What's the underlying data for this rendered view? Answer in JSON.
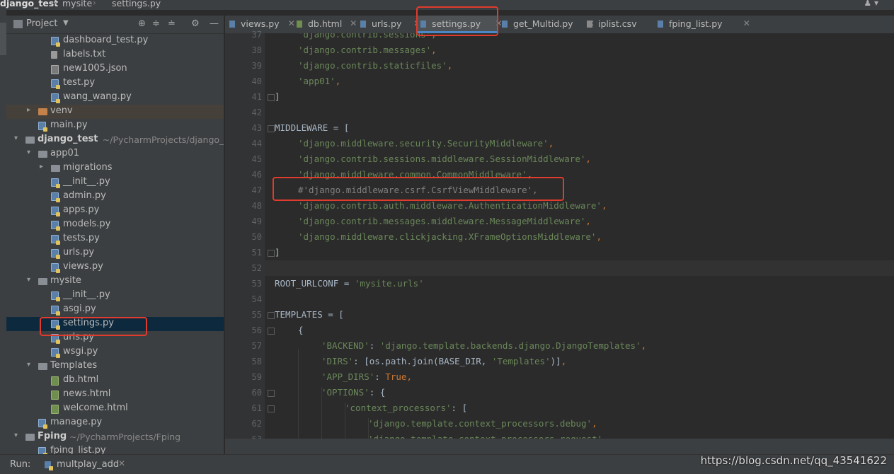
{
  "breadcrumb": {
    "project": "django_test",
    "folder": "mysite",
    "file": "settings.py",
    "user_icon": "user-icon"
  },
  "project_panel": {
    "title": "Project",
    "dropdown_icon": "chevron-down-icon"
  },
  "tree": [
    {
      "indent": 2,
      "arrow": "",
      "icon": "py",
      "name": "dashboard_test.py"
    },
    {
      "indent": 2,
      "arrow": "",
      "icon": "txt",
      "name": "labels.txt"
    },
    {
      "indent": 2,
      "arrow": "",
      "icon": "json",
      "name": "new1005.json"
    },
    {
      "indent": 2,
      "arrow": "",
      "icon": "py",
      "name": "test.py"
    },
    {
      "indent": 2,
      "arrow": "",
      "icon": "py",
      "name": "wang_wang.py"
    },
    {
      "indent": 1,
      "arrow": "right",
      "icon": "folder-orange",
      "name": "venv"
    },
    {
      "indent": 1,
      "arrow": "",
      "icon": "py",
      "name": "main.py"
    },
    {
      "indent": 0,
      "arrow": "down",
      "icon": "folder",
      "name": "django_test",
      "bold": true,
      "path": "~/PycharmProjects/django_tes"
    },
    {
      "indent": 1,
      "arrow": "down",
      "icon": "folder",
      "name": "app01"
    },
    {
      "indent": 2,
      "arrow": "right",
      "icon": "folder",
      "name": "migrations"
    },
    {
      "indent": 2,
      "arrow": "",
      "icon": "py",
      "name": "__init__.py"
    },
    {
      "indent": 2,
      "arrow": "",
      "icon": "py",
      "name": "admin.py"
    },
    {
      "indent": 2,
      "arrow": "",
      "icon": "py",
      "name": "apps.py"
    },
    {
      "indent": 2,
      "arrow": "",
      "icon": "py",
      "name": "models.py"
    },
    {
      "indent": 2,
      "arrow": "",
      "icon": "py",
      "name": "tests.py"
    },
    {
      "indent": 2,
      "arrow": "",
      "icon": "py",
      "name": "urls.py"
    },
    {
      "indent": 2,
      "arrow": "",
      "icon": "py",
      "name": "views.py"
    },
    {
      "indent": 1,
      "arrow": "down",
      "icon": "folder",
      "name": "mysite"
    },
    {
      "indent": 2,
      "arrow": "",
      "icon": "py",
      "name": "__init__.py"
    },
    {
      "indent": 2,
      "arrow": "",
      "icon": "py",
      "name": "asgi.py"
    },
    {
      "indent": 2,
      "arrow": "",
      "icon": "py",
      "name": "settings.py",
      "selected": true
    },
    {
      "indent": 2,
      "arrow": "",
      "icon": "py",
      "name": "urls.py"
    },
    {
      "indent": 2,
      "arrow": "",
      "icon": "py",
      "name": "wsgi.py"
    },
    {
      "indent": 1,
      "arrow": "down",
      "icon": "folder",
      "name": "Templates"
    },
    {
      "indent": 2,
      "arrow": "",
      "icon": "html",
      "name": "db.html"
    },
    {
      "indent": 2,
      "arrow": "",
      "icon": "html",
      "name": "news.html"
    },
    {
      "indent": 2,
      "arrow": "",
      "icon": "html",
      "name": "welcome.html"
    },
    {
      "indent": 1,
      "arrow": "",
      "icon": "py",
      "name": "manage.py"
    },
    {
      "indent": 0,
      "arrow": "down",
      "icon": "folder",
      "name": "Fping",
      "bold": true,
      "path": "~/PycharmProjects/Fping"
    },
    {
      "indent": 1,
      "arrow": "",
      "icon": "py",
      "name": "fping_list.py"
    }
  ],
  "tabs": [
    {
      "label": "views.py",
      "icon": "py",
      "active": false
    },
    {
      "label": "db.html",
      "icon": "html",
      "active": false
    },
    {
      "label": "urls.py",
      "icon": "py",
      "active": false
    },
    {
      "label": "settings.py",
      "icon": "py",
      "active": true
    },
    {
      "label": "get_Multid.py",
      "icon": "py",
      "active": false
    },
    {
      "label": "iplist.csv",
      "icon": "csv",
      "active": false
    },
    {
      "label": "fping_list.py",
      "icon": "py",
      "active": false
    }
  ],
  "code_lines": [
    {
      "no": "37",
      "indent": 1,
      "parts": [
        {
          "t": "'django.contrib.sessions',",
          "c": "str"
        }
      ]
    },
    {
      "no": "38",
      "indent": 1,
      "parts": [
        {
          "t": "'django.contrib.messages'",
          "c": "str"
        },
        {
          "t": ",",
          "c": "kw"
        }
      ]
    },
    {
      "no": "39",
      "indent": 1,
      "parts": [
        {
          "t": "'django.contrib.staticfiles'",
          "c": "str"
        },
        {
          "t": ",",
          "c": "kw"
        }
      ]
    },
    {
      "no": "40",
      "indent": 1,
      "parts": [
        {
          "t": "'app01'",
          "c": "str"
        },
        {
          "t": ",",
          "c": "kw"
        }
      ]
    },
    {
      "no": "41",
      "indent": 0,
      "fold": true,
      "parts": [
        {
          "t": "]",
          "c": ""
        }
      ]
    },
    {
      "no": "42",
      "indent": 0,
      "parts": []
    },
    {
      "no": "43",
      "indent": 0,
      "fold": true,
      "parts": [
        {
          "t": "MIDDLEWARE = [",
          "c": ""
        }
      ]
    },
    {
      "no": "44",
      "indent": 1,
      "parts": [
        {
          "t": "'django.middleware.security.SecurityMiddleware'",
          "c": "str"
        },
        {
          "t": ",",
          "c": "kw"
        }
      ]
    },
    {
      "no": "45",
      "indent": 1,
      "parts": [
        {
          "t": "'django.contrib.sessions.middleware.SessionMiddleware'",
          "c": "str"
        },
        {
          "t": ",",
          "c": "kw"
        }
      ]
    },
    {
      "no": "46",
      "indent": 1,
      "parts": [
        {
          "t": "'django.middleware.common.CommonMiddleware'",
          "c": "str"
        },
        {
          "t": ",",
          "c": "kw"
        }
      ]
    },
    {
      "no": "47",
      "indent": 1,
      "parts": [
        {
          "t": "#'django.middleware.csrf.CsrfViewMiddleware',",
          "c": "cm"
        }
      ]
    },
    {
      "no": "48",
      "indent": 1,
      "parts": [
        {
          "t": "'django.contrib.auth.middleware.AuthenticationMiddleware'",
          "c": "str"
        },
        {
          "t": ",",
          "c": "kw"
        }
      ]
    },
    {
      "no": "49",
      "indent": 1,
      "parts": [
        {
          "t": "'django.contrib.messages.middleware.MessageMiddleware'",
          "c": "str"
        },
        {
          "t": ",",
          "c": "kw"
        }
      ]
    },
    {
      "no": "50",
      "indent": 1,
      "parts": [
        {
          "t": "'django.middleware.clickjacking.XFrameOptionsMiddleware'",
          "c": "str"
        },
        {
          "t": ",",
          "c": "kw"
        }
      ]
    },
    {
      "no": "51",
      "indent": 0,
      "fold": true,
      "parts": [
        {
          "t": "]",
          "c": ""
        }
      ]
    },
    {
      "no": "52",
      "indent": 0,
      "current": true,
      "parts": []
    },
    {
      "no": "53",
      "indent": 0,
      "parts": [
        {
          "t": "ROOT_URLCONF = ",
          "c": ""
        },
        {
          "t": "'mysite.urls'",
          "c": "str"
        }
      ]
    },
    {
      "no": "54",
      "indent": 0,
      "parts": []
    },
    {
      "no": "55",
      "indent": 0,
      "fold": true,
      "parts": [
        {
          "t": "TEMPLATES = [",
          "c": ""
        }
      ]
    },
    {
      "no": "56",
      "indent": 1,
      "fold": true,
      "parts": [
        {
          "t": "{",
          "c": ""
        }
      ]
    },
    {
      "no": "57",
      "indent": 2,
      "parts": [
        {
          "t": "'BACKEND'",
          "c": "str"
        },
        {
          "t": ": ",
          "c": ""
        },
        {
          "t": "'django.template.backends.django.DjangoTemplates'",
          "c": "str"
        },
        {
          "t": ",",
          "c": "kw"
        }
      ]
    },
    {
      "no": "58",
      "indent": 2,
      "parts": [
        {
          "t": "'DIRS'",
          "c": "str"
        },
        {
          "t": ": [os.path.join(BASE_DIR, ",
          "c": ""
        },
        {
          "t": "'Templates'",
          "c": "str"
        },
        {
          "t": ")]",
          "c": ""
        },
        {
          "t": ",",
          "c": "kw"
        }
      ]
    },
    {
      "no": "59",
      "indent": 2,
      "parts": [
        {
          "t": "'APP_DIRS'",
          "c": "str"
        },
        {
          "t": ": ",
          "c": ""
        },
        {
          "t": "True",
          "c": "kw"
        },
        {
          "t": ",",
          "c": "kw"
        }
      ]
    },
    {
      "no": "60",
      "indent": 2,
      "fold": true,
      "parts": [
        {
          "t": "'OPTIONS'",
          "c": "str"
        },
        {
          "t": ": {",
          "c": ""
        }
      ]
    },
    {
      "no": "61",
      "indent": 3,
      "fold": true,
      "parts": [
        {
          "t": "'context_processors'",
          "c": "str"
        },
        {
          "t": ": [",
          "c": ""
        }
      ]
    },
    {
      "no": "62",
      "indent": 4,
      "parts": [
        {
          "t": "'django.template.context_processors.debug'",
          "c": "str"
        },
        {
          "t": ",",
          "c": "kw"
        }
      ]
    },
    {
      "no": "63",
      "indent": 4,
      "parts": [
        {
          "t": "'django.template.context_processors.request'",
          "c": "str"
        },
        {
          "t": ",",
          "c": "kw"
        }
      ]
    }
  ],
  "run_bar": {
    "label": "Run:",
    "config": "multplay_add"
  },
  "watermark": "https://blog.csdn.net/qq_43541622"
}
